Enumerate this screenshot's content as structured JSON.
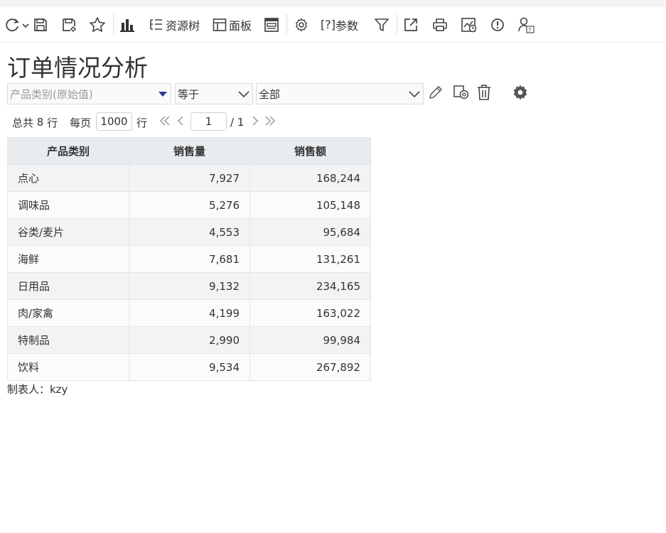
{
  "toolbar": {
    "items": [
      {
        "name": "refresh-icon"
      },
      {
        "name": "save-icon"
      },
      {
        "name": "save-as-icon"
      },
      {
        "name": "favorite-icon"
      },
      {
        "name": "chart-icon"
      },
      {
        "name": "resource-tree-icon",
        "label": "资源树"
      },
      {
        "name": "panel-icon",
        "label": "面板"
      },
      {
        "name": "layout-icon"
      },
      {
        "name": "settings-icon"
      },
      {
        "name": "params-icon",
        "label": "参数"
      },
      {
        "name": "filter-icon"
      },
      {
        "name": "export-icon"
      },
      {
        "name": "print-icon"
      },
      {
        "name": "schedule-icon"
      },
      {
        "name": "alert-icon"
      },
      {
        "name": "user-help-icon"
      }
    ],
    "params_prefix": "[?]"
  },
  "report": {
    "title": "订单情况分析",
    "footer": "制表人：kzy"
  },
  "filter": {
    "field_placeholder": "产品类别(原始值)",
    "operator": "等于",
    "value": "全部"
  },
  "pager": {
    "total_prefix": "总共",
    "total_rows": "8",
    "rows_unit": "行",
    "per_page_label": "每页",
    "per_page": "1000",
    "per_page_unit": "行",
    "current_page": "1",
    "total_pages": "/ 1"
  },
  "table": {
    "headers": [
      "产品类别",
      "销售量",
      "销售额"
    ],
    "rows": [
      [
        "点心",
        "7,927",
        "168,244"
      ],
      [
        "调味品",
        "5,276",
        "105,148"
      ],
      [
        "谷类/麦片",
        "4,553",
        "95,684"
      ],
      [
        "海鲜",
        "7,681",
        "131,261"
      ],
      [
        "日用品",
        "9,132",
        "234,165"
      ],
      [
        "肉/家禽",
        "4,199",
        "163,022"
      ],
      [
        "特制品",
        "2,990",
        "99,984"
      ],
      [
        "饮料",
        "9,534",
        "267,892"
      ]
    ]
  },
  "colors": {
    "header_bg": "#e9ecef",
    "row_odd": "#f2f3f5",
    "row_even": "#fafbfb",
    "dropdown_arrow": "#2d3a8c"
  }
}
